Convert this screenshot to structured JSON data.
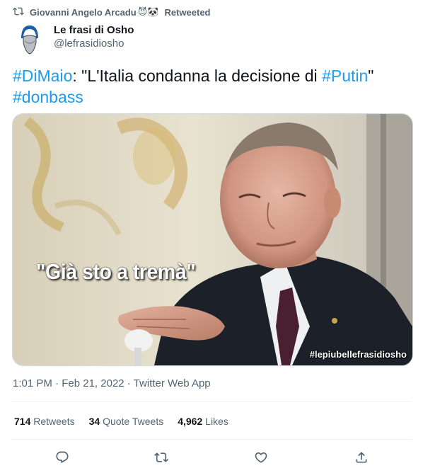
{
  "retweet": {
    "user": "Giovanni Angelo Arcadu",
    "emojis": "😈🐼",
    "label": "Retweeted",
    "icon": "retweet-icon"
  },
  "author": {
    "display_name": "Le frasi di Osho",
    "handle": "@lefrasidiosho"
  },
  "tweet": {
    "hashtag_1": "#DiMaio",
    "text_1": ": \"L'Italia condanna la decisione di ",
    "hashtag_2": "#Putin",
    "text_2": "\"",
    "hashtag_3": "#donbass"
  },
  "media": {
    "caption": "\"Già sto a tremà\"",
    "watermark": "#lepiubellefrasidiosho"
  },
  "meta": {
    "time": "1:01 PM",
    "sep1": " · ",
    "date": "Feb 21, 2022",
    "sep2": " · ",
    "source": "Twitter Web App"
  },
  "stats": {
    "retweets_count": "714",
    "retweets_label": "Retweets",
    "quotes_count": "34",
    "quotes_label": "Quote Tweets",
    "likes_count": "4,962",
    "likes_label": "Likes"
  },
  "colors": {
    "link": "#1d9bf0",
    "secondary": "#536471",
    "primary_text": "#0f1419",
    "divider": "#eff3f4"
  }
}
